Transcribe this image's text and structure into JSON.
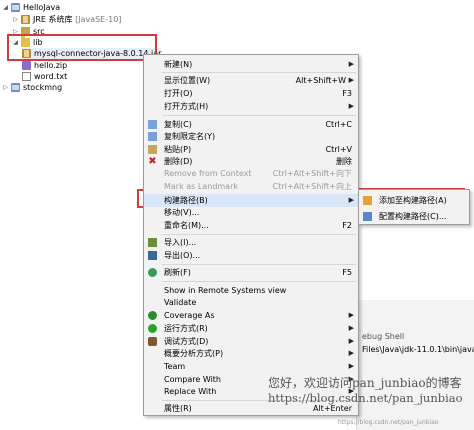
{
  "tree": {
    "rows": [
      {
        "label": "HelloJava"
      },
      {
        "label": "JRE 系统库",
        "badge": "[JavaSE-10]"
      },
      {
        "label": "src"
      },
      {
        "label": "lib"
      },
      {
        "label": "mysql-connector-java-8.0.14.jar"
      },
      {
        "label": "hello.zip"
      },
      {
        "label": "word.txt"
      },
      {
        "label": "stockmng"
      }
    ]
  },
  "menu": {
    "items": [
      {
        "label": "新建(N)",
        "shortcut": ""
      },
      {
        "label": "显示位置(W)",
        "shortcut": "Alt+Shift+W"
      },
      {
        "label": "打开(O)",
        "shortcut": "F3"
      },
      {
        "label": "打开方式(H)",
        "shortcut": ""
      },
      {
        "label": "复制(C)",
        "shortcut": "Ctrl+C"
      },
      {
        "label": "复制限定名(Y)",
        "shortcut": ""
      },
      {
        "label": "粘贴(P)",
        "shortcut": "Ctrl+V"
      },
      {
        "label": "删除(D)",
        "shortcut": "删除"
      },
      {
        "label": "Remove from Context",
        "shortcut": "Ctrl+Alt+Shift+向下"
      },
      {
        "label": "Mark as Landmark",
        "shortcut": "Ctrl+Alt+Shift+向上"
      },
      {
        "label": "构建路径(B)",
        "shortcut": ""
      },
      {
        "label": "移动(V)...",
        "shortcut": ""
      },
      {
        "label": "重命名(M)...",
        "shortcut": "F2"
      },
      {
        "label": "导入(I)...",
        "shortcut": ""
      },
      {
        "label": "导出(O)...",
        "shortcut": ""
      },
      {
        "label": "刷新(F)",
        "shortcut": "F5"
      },
      {
        "label": "Show in Remote Systems view",
        "shortcut": ""
      },
      {
        "label": "Validate",
        "shortcut": ""
      },
      {
        "label": "Coverage As",
        "shortcut": ""
      },
      {
        "label": "运行方式(R)",
        "shortcut": ""
      },
      {
        "label": "调试方式(D)",
        "shortcut": ""
      },
      {
        "label": "概要分析方式(P)",
        "shortcut": ""
      },
      {
        "label": "Team",
        "shortcut": ""
      },
      {
        "label": "Compare With",
        "shortcut": ""
      },
      {
        "label": "Replace With",
        "shortcut": ""
      },
      {
        "label": "属性(R)",
        "shortcut": "Alt+Enter"
      }
    ]
  },
  "submenu": {
    "items": [
      {
        "label": "添加至构建路径(A)"
      },
      {
        "label": "配置构建路径(C)..."
      }
    ]
  },
  "console": {
    "tab": "ebug Shell",
    "path": "Files\\Java\\jdk-11.0.1\\bin\\javaw.e"
  },
  "watermark": {
    "line1": "您好，欢迎访问pan_junbiao的博客",
    "line2": "https://blog.csdn.net/pan_junbiao",
    "corner": "https://blog.csdn.net/pan_junbiao"
  },
  "colors": {
    "highlight_box": "#d43c3c",
    "menu_bg": "#f2f2f2"
  }
}
